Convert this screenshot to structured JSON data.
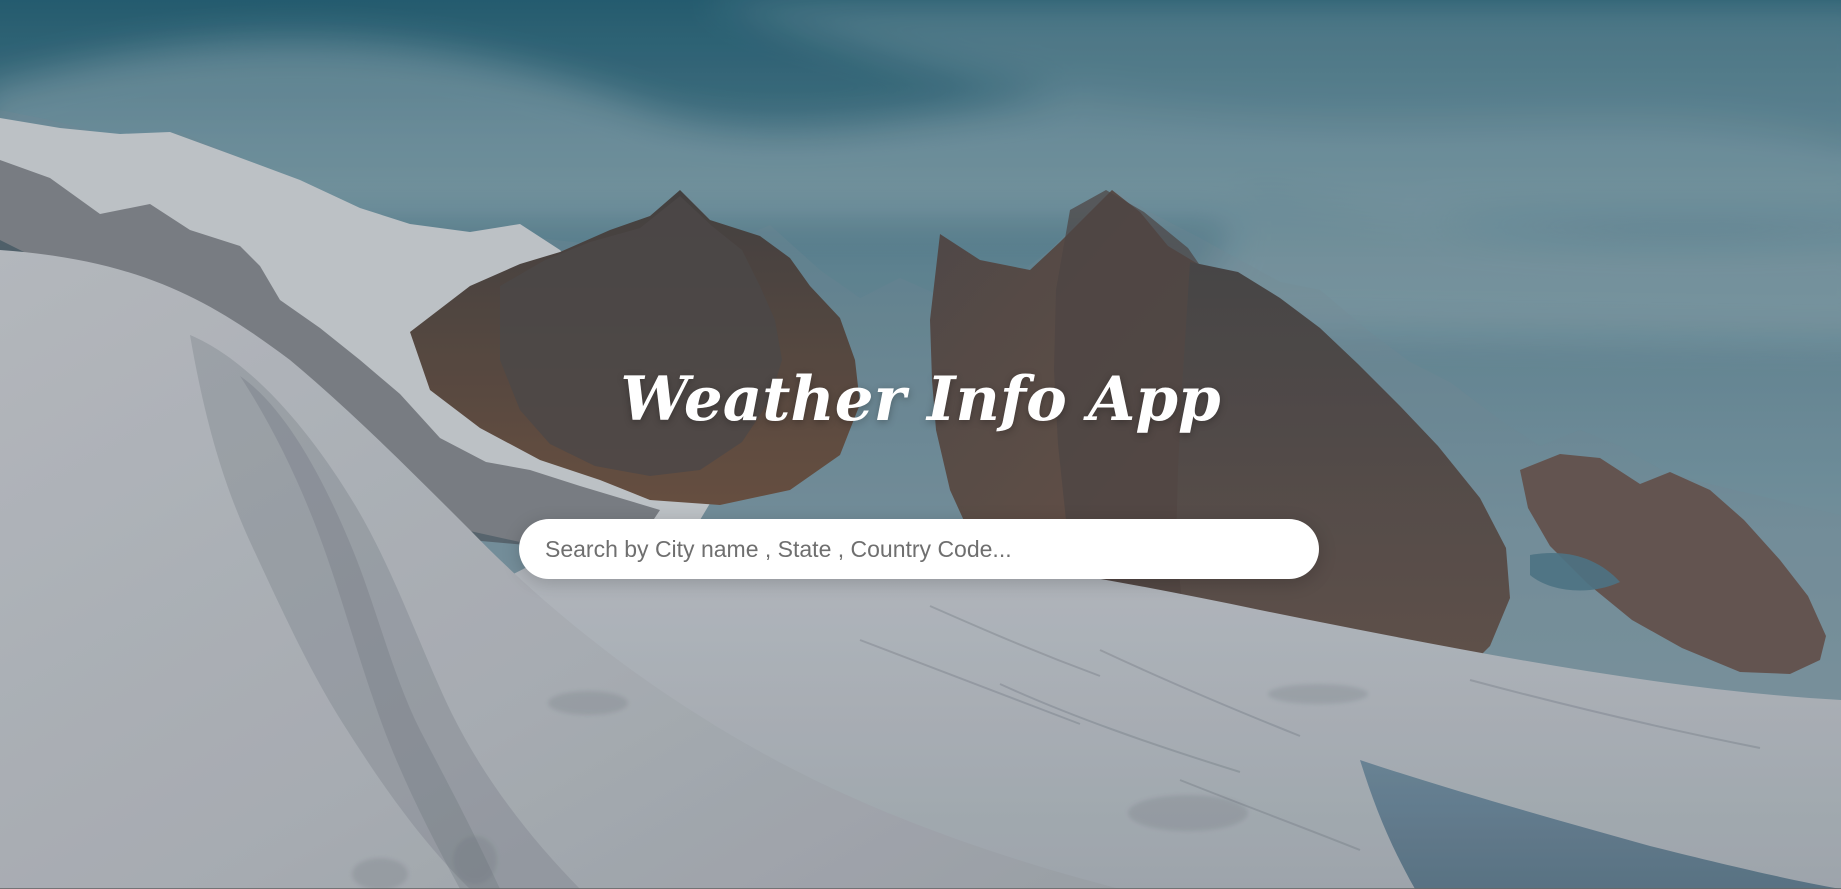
{
  "app": {
    "title": "Weather Info App"
  },
  "search": {
    "placeholder": "Search by City name , State , Country Code...",
    "value": ""
  },
  "background": {
    "subject": "mountain-landscape"
  }
}
